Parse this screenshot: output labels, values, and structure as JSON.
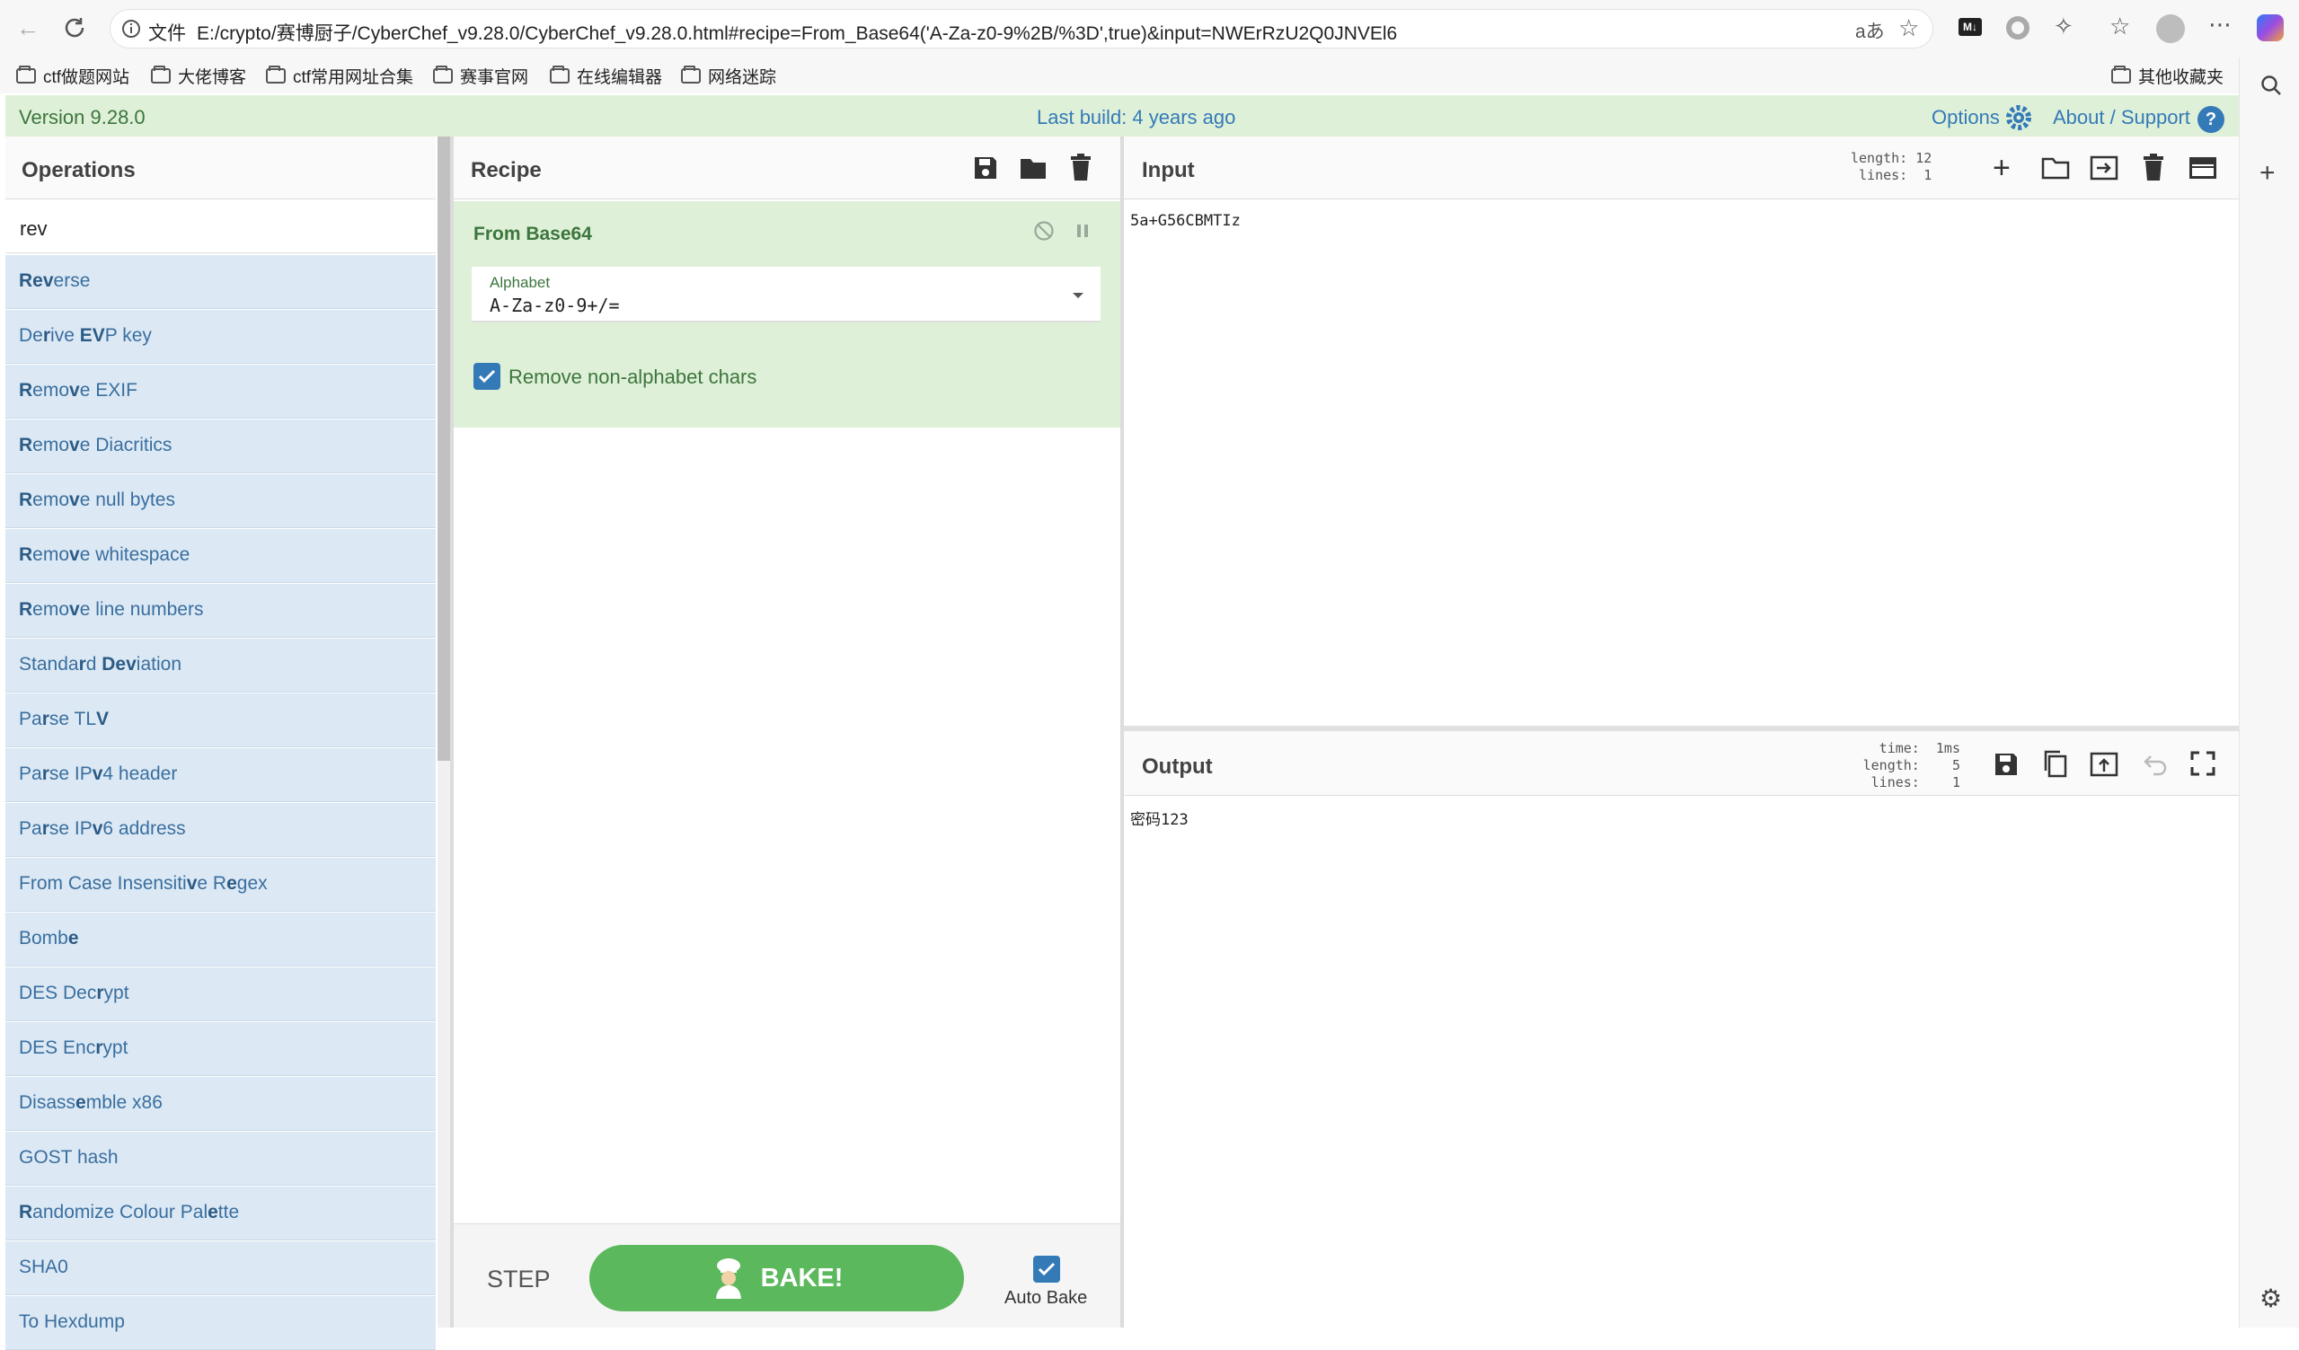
{
  "browser": {
    "url_prefix": "文件",
    "url": "E:/crypto/赛博厨子/CyberChef_v9.28.0/CyberChef_v9.28.0.html#recipe=From_Base64('A-Za-z0-9%2B/%3D',true)&input=NWErRzU2Q0JNVEl6",
    "read_aloud": "aあ",
    "bookmarks": [
      "ctf做题网站",
      "大佬博客",
      "ctf常用网址合集",
      "赛事官网",
      "在线编辑器",
      "网络迷踪"
    ],
    "other_bookmarks": "其他收藏夹"
  },
  "banner": {
    "version": "Version 9.28.0",
    "last_build": "Last build: 4 years ago",
    "options": "Options",
    "about": "About / Support"
  },
  "operations": {
    "title": "Operations",
    "search_value": "rev",
    "items": [
      {
        "pre": "",
        "b1": "Rev",
        "mid": "erse",
        "b2": "",
        "post": ""
      },
      {
        "pre": "De",
        "b1": "r",
        "mid": "ive ",
        "b2": "EV",
        "post": "P key"
      },
      {
        "pre": "",
        "b1": "R",
        "mid": "emo",
        "b2": "v",
        "post": "e EXIF"
      },
      {
        "pre": "",
        "b1": "R",
        "mid": "emo",
        "b2": "v",
        "post": "e Diacritics"
      },
      {
        "pre": "",
        "b1": "R",
        "mid": "emo",
        "b2": "v",
        "post": "e null bytes"
      },
      {
        "pre": "",
        "b1": "R",
        "mid": "emo",
        "b2": "v",
        "post": "e whitespace"
      },
      {
        "pre": "",
        "b1": "R",
        "mid": "emo",
        "b2": "v",
        "post": "e line numbers"
      },
      {
        "pre": "Standa",
        "b1": "r",
        "mid": "d ",
        "b2": "Dev",
        "post": "iation"
      },
      {
        "pre": "Pa",
        "b1": "r",
        "mid": "se TL",
        "b2": "V",
        "post": ""
      },
      {
        "pre": "Pa",
        "b1": "r",
        "mid": "se IP",
        "b2": "v",
        "post": "4 header"
      },
      {
        "pre": "Pa",
        "b1": "r",
        "mid": "se IP",
        "b2": "v",
        "post": "6 address"
      },
      {
        "pre": "From Case Insensiti",
        "b1": "v",
        "mid": "e R",
        "b2": "e",
        "post": "gex"
      },
      {
        "pre": "Bomb",
        "b1": "e",
        "mid": "",
        "b2": "",
        "post": ""
      },
      {
        "pre": "DES Dec",
        "b1": "r",
        "mid": "ypt",
        "b2": "",
        "post": ""
      },
      {
        "pre": "DES Enc",
        "b1": "r",
        "mid": "ypt",
        "b2": "",
        "post": ""
      },
      {
        "pre": "Disass",
        "b1": "e",
        "mid": "mble x86",
        "b2": "",
        "post": ""
      },
      {
        "pre": "GOST hash",
        "b1": "",
        "mid": "",
        "b2": "",
        "post": ""
      },
      {
        "pre": "",
        "b1": "R",
        "mid": "andomize Colour Pal",
        "b2": "e",
        "post": "tte"
      },
      {
        "pre": "SHA0",
        "b1": "",
        "mid": "",
        "b2": "",
        "post": ""
      },
      {
        "pre": "To Hexdump",
        "b1": "",
        "mid": "",
        "b2": "",
        "post": ""
      }
    ]
  },
  "recipe": {
    "title": "Recipe",
    "operation": {
      "name": "From Base64",
      "alphabet_label": "Alphabet",
      "alphabet_value": "A-Za-z0-9+/=",
      "remove_label": "Remove non-alphabet chars",
      "remove_checked": true
    },
    "step": "STEP",
    "bake": "BAKE!",
    "auto_bake": "Auto Bake",
    "auto_bake_checked": true
  },
  "input": {
    "title": "Input",
    "stats": "length: 12\n lines:  1",
    "value": "5a+G56CBMTIz"
  },
  "output": {
    "title": "Output",
    "stats": "  time:  1ms\nlength:    5\n lines:    1",
    "value": "密码123"
  },
  "colors": {
    "banner_bg": "#dff0d8",
    "ops_item_bg": "#dce9f5",
    "recipe_bg": "#dff0d8",
    "bake_green": "#5cb85c",
    "link_blue": "#337ab7"
  }
}
